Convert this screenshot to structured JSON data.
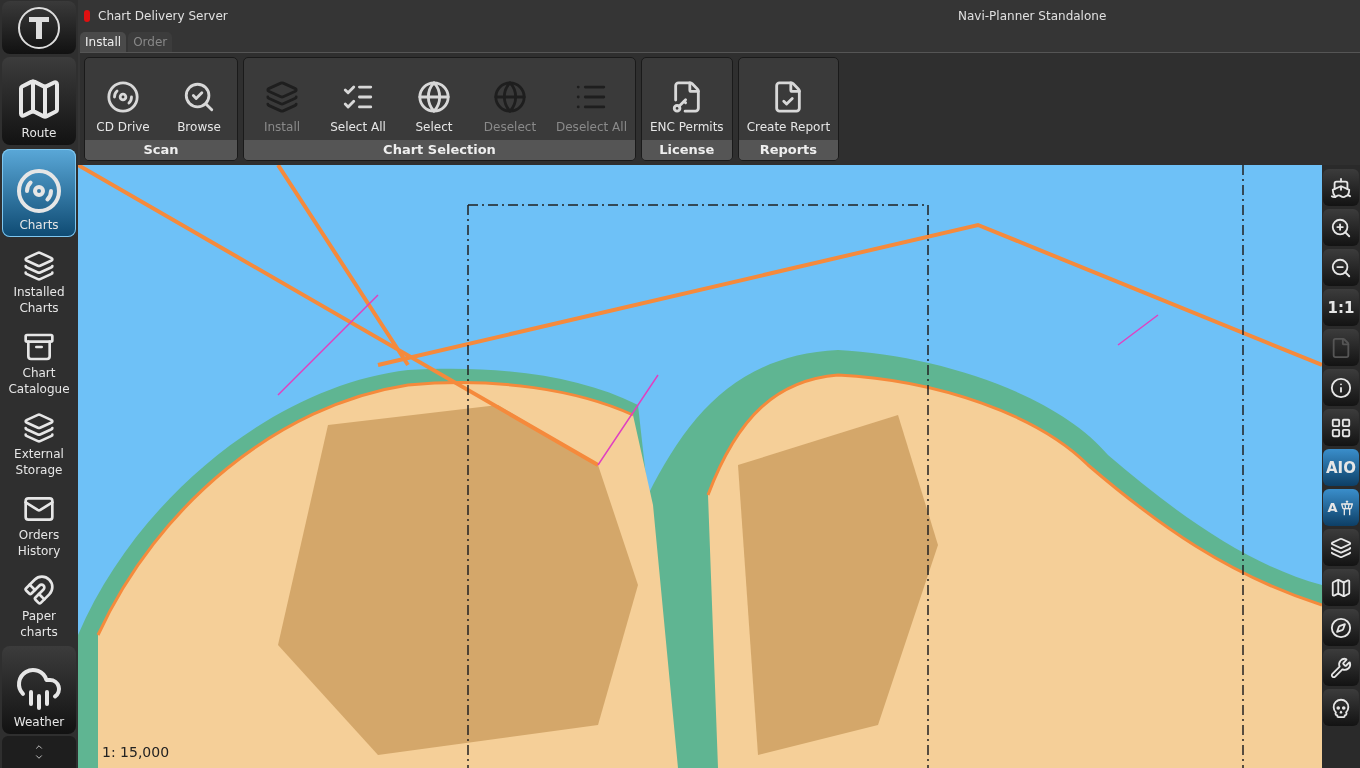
{
  "status_indicator": {
    "label": "Chart Delivery Server",
    "on": true
  },
  "window": {
    "title": "Navi-Planner Standalone"
  },
  "tabs": [
    {
      "label": "Install",
      "selected": true
    },
    {
      "label": "Order",
      "selected": false
    }
  ],
  "ribbon_groups": [
    {
      "title": "Scan",
      "buttons": [
        {
          "label": "CD Drive",
          "disabled": false
        },
        {
          "label": "Browse",
          "disabled": false
        }
      ]
    },
    {
      "title": "Chart Selection",
      "buttons": [
        {
          "label": "Install",
          "disabled": true
        },
        {
          "label": "Select All",
          "disabled": false
        },
        {
          "label": "Select",
          "disabled": false
        },
        {
          "label": "Deselect",
          "disabled": true
        },
        {
          "label": "Deselect All",
          "disabled": true
        }
      ]
    },
    {
      "title": "License",
      "buttons": [
        {
          "label": "ENC Permits",
          "disabled": false
        }
      ]
    },
    {
      "title": "Reports",
      "buttons": [
        {
          "label": "Create Report",
          "disabled": false
        }
      ]
    }
  ],
  "sidebar": {
    "items": [
      {
        "kind": "big",
        "label": "Route",
        "selected": false
      },
      {
        "kind": "big",
        "label": "Charts",
        "selected": true
      },
      {
        "kind": "small",
        "label": "Installed Charts",
        "selected": false
      },
      {
        "kind": "small",
        "label": "Chart Catalogue",
        "selected": false
      },
      {
        "kind": "small",
        "label": "External Storage",
        "selected": false
      },
      {
        "kind": "small",
        "label": "Orders History",
        "selected": false
      },
      {
        "kind": "small",
        "label": "Paper charts",
        "selected": false
      },
      {
        "kind": "big",
        "label": "Weather",
        "selected": false
      }
    ]
  },
  "map": {
    "scale": "1: 15,000"
  },
  "right_toolbar": [
    {
      "kind": "icon",
      "active": false,
      "disabled": false
    },
    {
      "kind": "icon",
      "active": false,
      "disabled": false
    },
    {
      "kind": "icon",
      "active": false,
      "disabled": false
    },
    {
      "kind": "text",
      "label": "1:1",
      "active": false,
      "disabled": false
    },
    {
      "kind": "icon",
      "active": false,
      "disabled": true
    },
    {
      "kind": "icon",
      "active": false,
      "disabled": false
    },
    {
      "kind": "icon",
      "active": false,
      "disabled": false
    },
    {
      "kind": "text",
      "label": "AIO",
      "active": true,
      "disabled": false
    },
    {
      "kind": "labeled",
      "label": "A",
      "active": true,
      "disabled": false
    },
    {
      "kind": "icon",
      "active": false,
      "disabled": false
    },
    {
      "kind": "icon",
      "active": false,
      "disabled": false
    },
    {
      "kind": "icon",
      "active": false,
      "disabled": false
    },
    {
      "kind": "icon",
      "active": false,
      "disabled": false
    },
    {
      "kind": "icon",
      "active": false,
      "disabled": false
    }
  ]
}
